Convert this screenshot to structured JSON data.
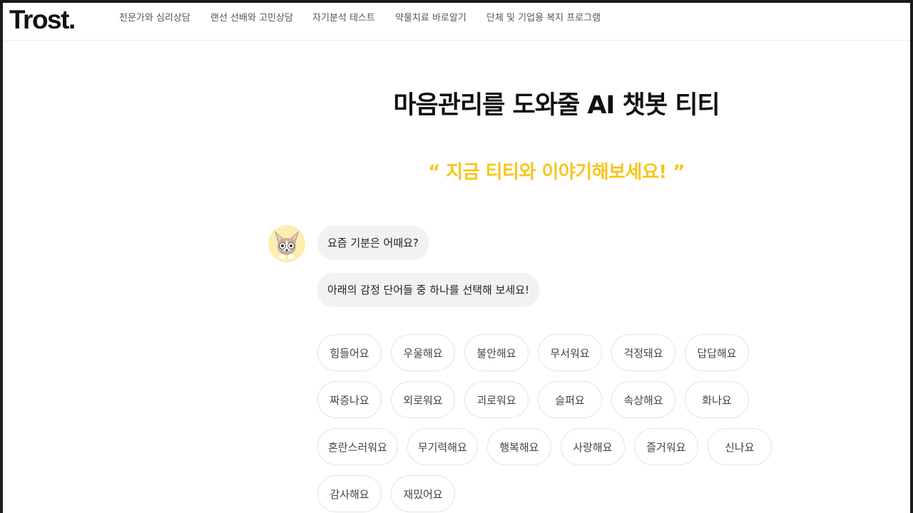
{
  "header": {
    "logo": "Trost.",
    "nav": [
      "전문가와 심리상담",
      "랜선 선배와 고민상담",
      "자기분석 테스트",
      "약물치료 바로알기",
      "단체 및 기업용 복지 프로그램"
    ]
  },
  "main": {
    "title": "마음관리를 도와줄 AI 챗봇 티티",
    "subtitle": "“ 지금 티티와 이야기해보세요! ”",
    "avatar_icon": "fox-character-icon",
    "messages": [
      "요즘 기분은 어때요?",
      "아래의 감정 단어들 중 하나를 선택해 보세요!"
    ],
    "emotions": [
      "힘들어요",
      "우울해요",
      "불안해요",
      "무서워요",
      "걱정돼요",
      "답답해요",
      "짜증나요",
      "외로워요",
      "괴로워요",
      "슬퍼요",
      "속상해요",
      "화나요",
      "혼란스러워요",
      "무기력해요",
      "행복해요",
      "사랑해요",
      "즐거워요",
      "신나요",
      "감사해요",
      "재밌어요"
    ]
  }
}
